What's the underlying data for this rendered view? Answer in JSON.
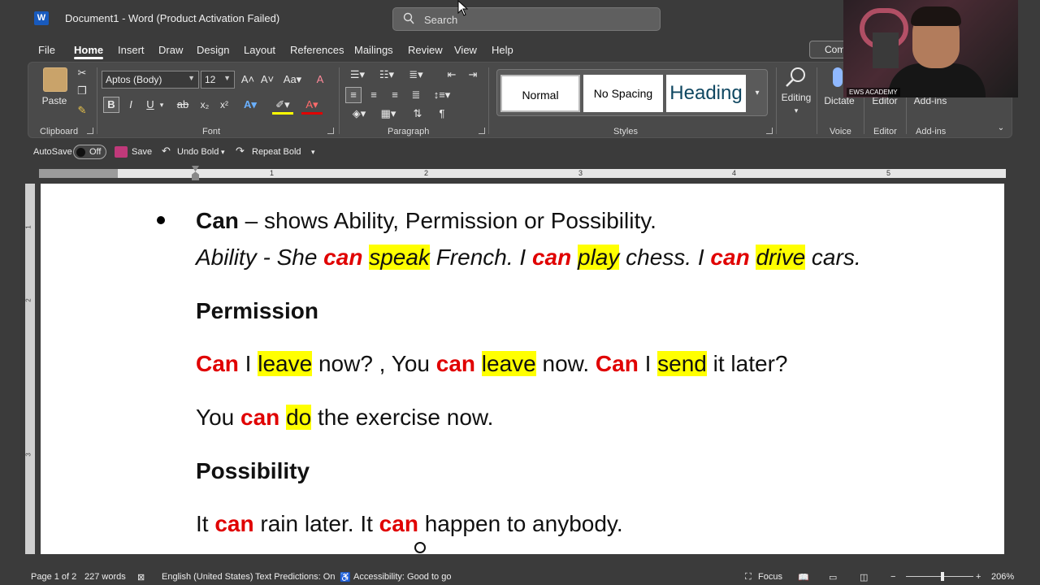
{
  "titlebar": {
    "app_icon": "W",
    "document_title": "Document1  -  Word (Product Activation Failed)",
    "search_placeholder": "Search"
  },
  "menu": {
    "items": [
      "File",
      "Home",
      "Insert",
      "Draw",
      "Design",
      "Layout",
      "References",
      "Mailings",
      "Review",
      "View",
      "Help"
    ],
    "active": "Home",
    "comments_label": "Comments"
  },
  "ribbon": {
    "clipboard": {
      "paste_label": "Paste",
      "group_label": "Clipboard"
    },
    "font": {
      "font_name": "Aptos (Body)",
      "font_size": "12",
      "group_label": "Font",
      "bold": "B",
      "italic": "I",
      "underline": "U",
      "strike": "ab",
      "subscript": "x₂",
      "superscript": "x²"
    },
    "paragraph": {
      "group_label": "Paragraph"
    },
    "styles": {
      "group_label": "Styles",
      "items": [
        "Normal",
        "No Spacing",
        "Heading"
      ]
    },
    "editing": {
      "label": "Editing"
    },
    "voice": {
      "dictate_label": "Dictate",
      "group_label": "Voice"
    },
    "editor": {
      "label": "Editor",
      "group_label": "Editor"
    },
    "addins": {
      "label": "Add-ins",
      "group_label": "Add-ins"
    }
  },
  "qat": {
    "autosave_label": "AutoSave",
    "autosave_state": "Off",
    "save_label": "Save",
    "undo_label": "Undo Bold",
    "repeat_label": "Repeat Bold"
  },
  "ruler": {
    "numbers": [
      "1",
      "2",
      "3",
      "4",
      "5"
    ]
  },
  "vruler": {
    "numbers": [
      "1",
      "2",
      "3"
    ]
  },
  "document": {
    "line1": {
      "bold": "Can",
      "rest": " – shows Ability, Permission or Possibility."
    },
    "line2": {
      "t1": "Ability - She ",
      "r1": "can",
      "h1": "speak",
      "t2": " French. I ",
      "r2": "can",
      "h2": "play",
      "t3": " chess. I ",
      "r3": "can",
      "h3": "drive",
      "t4": " cars."
    },
    "heading_permission": "Permission",
    "line4": {
      "r1": "Can",
      "t1": " I ",
      "h1": "leave",
      "t2": " now? , You ",
      "r2": "can",
      "t3": " ",
      "h2": "leave",
      "t4": " now. ",
      "r3": "Can",
      "t5": " I ",
      "h3": "send",
      "t6": " it later?"
    },
    "line5": {
      "t1": "You ",
      "r1": "can",
      "t2": " ",
      "h1": "do",
      "t3": " the exercise now."
    },
    "heading_possibility": "Possibility",
    "line7": {
      "t1": "It ",
      "r1": "can",
      "t2": " rain later. It ",
      "r2": "can",
      "t3": " happen to anybody."
    }
  },
  "webcam": {
    "caption": "EWS ACADEMY"
  },
  "statusbar": {
    "page": "Page 1 of 2",
    "words": "227 words",
    "language": "English (United States)",
    "predictions": "Text Predictions: On",
    "accessibility": "Accessibility: Good to go",
    "focus": "Focus",
    "zoom": "206%"
  },
  "colors": {
    "accent_red": "#e00000",
    "highlight": "#ffff00",
    "chrome": "#3b3b3b"
  }
}
